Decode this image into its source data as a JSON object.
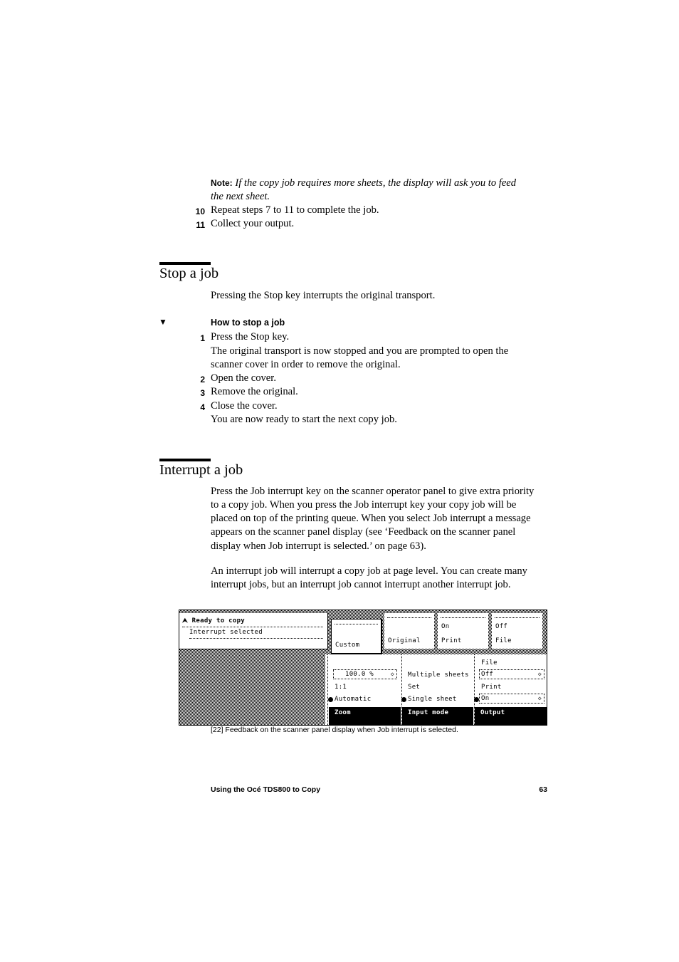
{
  "note": {
    "label": "Note:",
    "text": "If the copy job requires more sheets, the display will ask you to feed",
    "text_line2": "the next sheet."
  },
  "steps_top": [
    {
      "num": "10",
      "text": "Repeat steps 7 to 11 to complete the job."
    },
    {
      "num": "11",
      "text": "Collect your output."
    }
  ],
  "section_stop": {
    "title": "Stop a job",
    "intro": "Pressing the Stop key interrupts the original transport.",
    "procedure_marker": "▼",
    "procedure_title": "How to stop a job",
    "steps": [
      {
        "num": "1",
        "text": "Press the Stop key."
      },
      {
        "num": "2",
        "text": "Open the cover."
      },
      {
        "num": "3",
        "text": "Remove the original."
      },
      {
        "num": "4",
        "text": "Close the cover."
      }
    ],
    "step1_detail_line1": "The original transport is now stopped and you are prompted to open the",
    "step1_detail_line2": "scanner cover in order to remove the original.",
    "step4_detail": "You are now ready to start the next copy job."
  },
  "section_interrupt": {
    "title": "Interrupt a job",
    "para1_lines": [
      "Press the Job interrupt key on the scanner operator panel to give extra priority",
      "to a copy job. When you press the Job interrupt key your copy job will be",
      "placed on top of the printing queue. When you select Job interrupt a message",
      "appears on the scanner panel display (see ‘Feedback on the scanner panel",
      "display when Job interrupt is selected.’ on page 63)."
    ],
    "para2_lines": [
      "An interrupt job will interrupt a copy job at page level. You can create many",
      "interrupt jobs, but an interrupt job cannot interrupt another interrupt job."
    ]
  },
  "panel": {
    "status": {
      "icon": "⮝",
      "title": "Ready to copy",
      "message": "Interrupt selected"
    },
    "top_buttons": [
      {
        "sub": "",
        "label": "Custom",
        "selected": true
      },
      {
        "sub": "",
        "label": "Original",
        "selected": false
      },
      {
        "sub": "On",
        "label": "Print",
        "selected": false
      },
      {
        "sub": "Off",
        "label": "File",
        "selected": false
      }
    ],
    "zoom": {
      "value": "100.0 %",
      "ratio": "1:1",
      "option": "Automatic",
      "tab": "Zoom"
    },
    "input_mode": {
      "option1": "Multiple sheets",
      "option2": "Set",
      "option3": "Single sheet",
      "tab": "Input mode"
    },
    "output": {
      "file_label": "File",
      "file_value": "Off",
      "print_label": "Print",
      "print_value": "On",
      "tab": "Output"
    },
    "spin_icon": "◇"
  },
  "caption": "[22] Feedback on the scanner panel display when Job interrupt is selected.",
  "footer": {
    "title": "Using the Océ TDS800 to Copy",
    "page": "63"
  }
}
